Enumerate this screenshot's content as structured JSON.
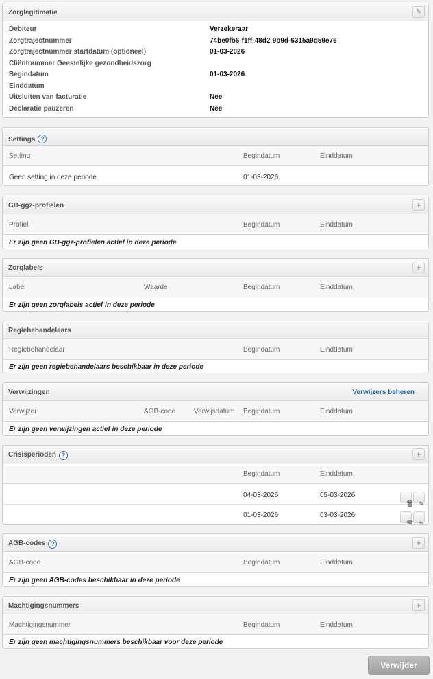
{
  "zorglegitimatie": {
    "title": "Zorglegitimatie",
    "fields": [
      {
        "label": "Debiteur",
        "value": "Verzekeraar"
      },
      {
        "label": "Zorgtrajectnummer",
        "value": "74be0fb6-f1ff-48d2-9b9d-6315a9d59e76"
      },
      {
        "label": "Zorgtrajectnummer startdatum (optioneel)",
        "value": "01-03-2026"
      },
      {
        "label": "Cliëntnummer Geestelijke gezondheidszorg",
        "value": ""
      },
      {
        "label": "Begindatum",
        "value": "01-03-2026"
      },
      {
        "label": "Einddatum",
        "value": ""
      },
      {
        "label": "Uitsluiten van facturatie",
        "value": "Nee"
      },
      {
        "label": "Declaratie pauzeren",
        "value": "Nee"
      }
    ]
  },
  "settings": {
    "title": "Settings",
    "columns": {
      "setting": "Setting",
      "begindatum": "Begindatum",
      "einddatum": "Einddatum"
    },
    "rows": [
      {
        "setting": "Geen setting in deze periode",
        "begindatum": "01-03-2026",
        "einddatum": ""
      }
    ]
  },
  "ggz_profielen": {
    "title": "GB-ggz-profielen",
    "columns": {
      "profiel": "Profiel",
      "begindatum": "Begindatum",
      "einddatum": "Einddatum"
    },
    "empty": "Er zijn geen GB-ggz-profielen actief in deze periode"
  },
  "zorglabels": {
    "title": "Zorglabels",
    "columns": {
      "label": "Label",
      "waarde": "Waarde",
      "begindatum": "Begindatum",
      "einddatum": "Einddatum"
    },
    "empty": "Er zijn geen zorglabels actief in deze periode"
  },
  "regiebehandelaars": {
    "title": "Regiebehandelaars",
    "columns": {
      "regiebehandelaar": "Regiebehandelaar",
      "begindatum": "Begindatum",
      "einddatum": "Einddatum"
    },
    "empty": "Er zijn geen regiebehandelaars beschikbaar in deze periode"
  },
  "verwijzingen": {
    "title": "Verwijzingen",
    "manage_link": "Verwijzers beheren",
    "columns": {
      "verwijzer": "Verwijzer",
      "agb": "AGB-code",
      "verwijsdatum": "Verwijsdatum",
      "begindatum": "Begindatum",
      "einddatum": "Einddatum"
    },
    "empty": "Er zijn geen verwijzingen actief in deze periode"
  },
  "crisisperioden": {
    "title": "Crisisperioden",
    "columns": {
      "begindatum": "Begindatum",
      "einddatum": "Einddatum"
    },
    "rows": [
      {
        "begindatum": "04-03-2026",
        "einddatum": "05-03-2026"
      },
      {
        "begindatum": "01-03-2026",
        "einddatum": "03-03-2026"
      }
    ]
  },
  "agb_codes": {
    "title": "AGB-codes",
    "columns": {
      "agb": "AGB-code",
      "begindatum": "Begindatum",
      "einddatum": "Einddatum"
    },
    "empty": "Er zijn geen AGB-codes beschikbaar in deze periode"
  },
  "machtigingsnummers": {
    "title": "Machtigingsnummers",
    "columns": {
      "nummer": "Machtigingsnummer",
      "begindatum": "Begindatum",
      "einddatum": "Einddatum"
    },
    "empty": "Er zijn geen machtigingsnummers beschikbaar voor deze periode"
  },
  "actions": {
    "delete_label": "Verwijder",
    "help_glyph": "?",
    "add_glyph": "+",
    "edit_glyph": "✎",
    "trash_glyph": "🗑"
  }
}
